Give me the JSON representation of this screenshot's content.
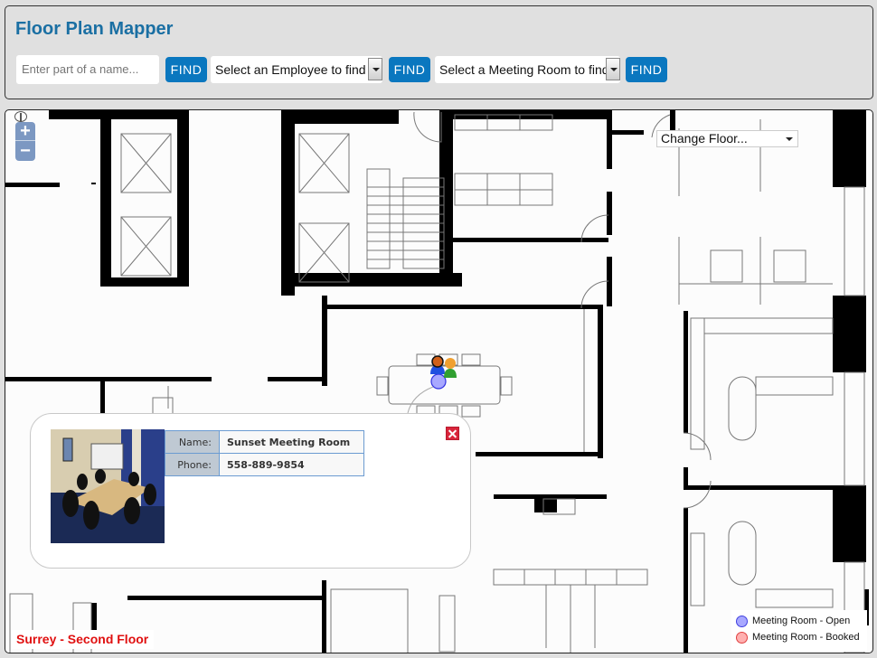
{
  "header": {
    "title": "Floor Plan Mapper",
    "name_search": {
      "placeholder": "Enter part of a name...",
      "value": ""
    },
    "find_button_label": "FIND",
    "employee_select": {
      "selected": "Select an Employee to find"
    },
    "meeting_room_select": {
      "selected": "Select a Meeting Room to find"
    }
  },
  "map": {
    "zoom_in_label": "+",
    "zoom_out_label": "−",
    "floor_select": {
      "selected": "Change Floor..."
    },
    "floor_label": "Surrey - Second Floor",
    "popup": {
      "rows": [
        {
          "label": "Name:",
          "value": "Sunset Meeting Room"
        },
        {
          "label": "Phone:",
          "value": "558-889-9854"
        }
      ],
      "photo_icon": "meeting-room-photo",
      "close_icon": "close-icon"
    },
    "markers": [
      {
        "type": "employee",
        "icon": "person-female-icon"
      },
      {
        "type": "employee",
        "icon": "person-male-icon"
      },
      {
        "type": "meeting-room-open",
        "icon": "meeting-room-marker-icon"
      }
    ],
    "legend": [
      {
        "label": "Meeting Room - Open",
        "color": "#a8a8ff",
        "border": "#4040e0"
      },
      {
        "label": "Meeting Room - Booked",
        "color": "#ffb0b0",
        "border": "#e04040"
      }
    ]
  },
  "colors": {
    "accent": "#0a77bf",
    "title": "#1a6fa3",
    "floor_label": "#e01010",
    "close": "#d9253b"
  }
}
